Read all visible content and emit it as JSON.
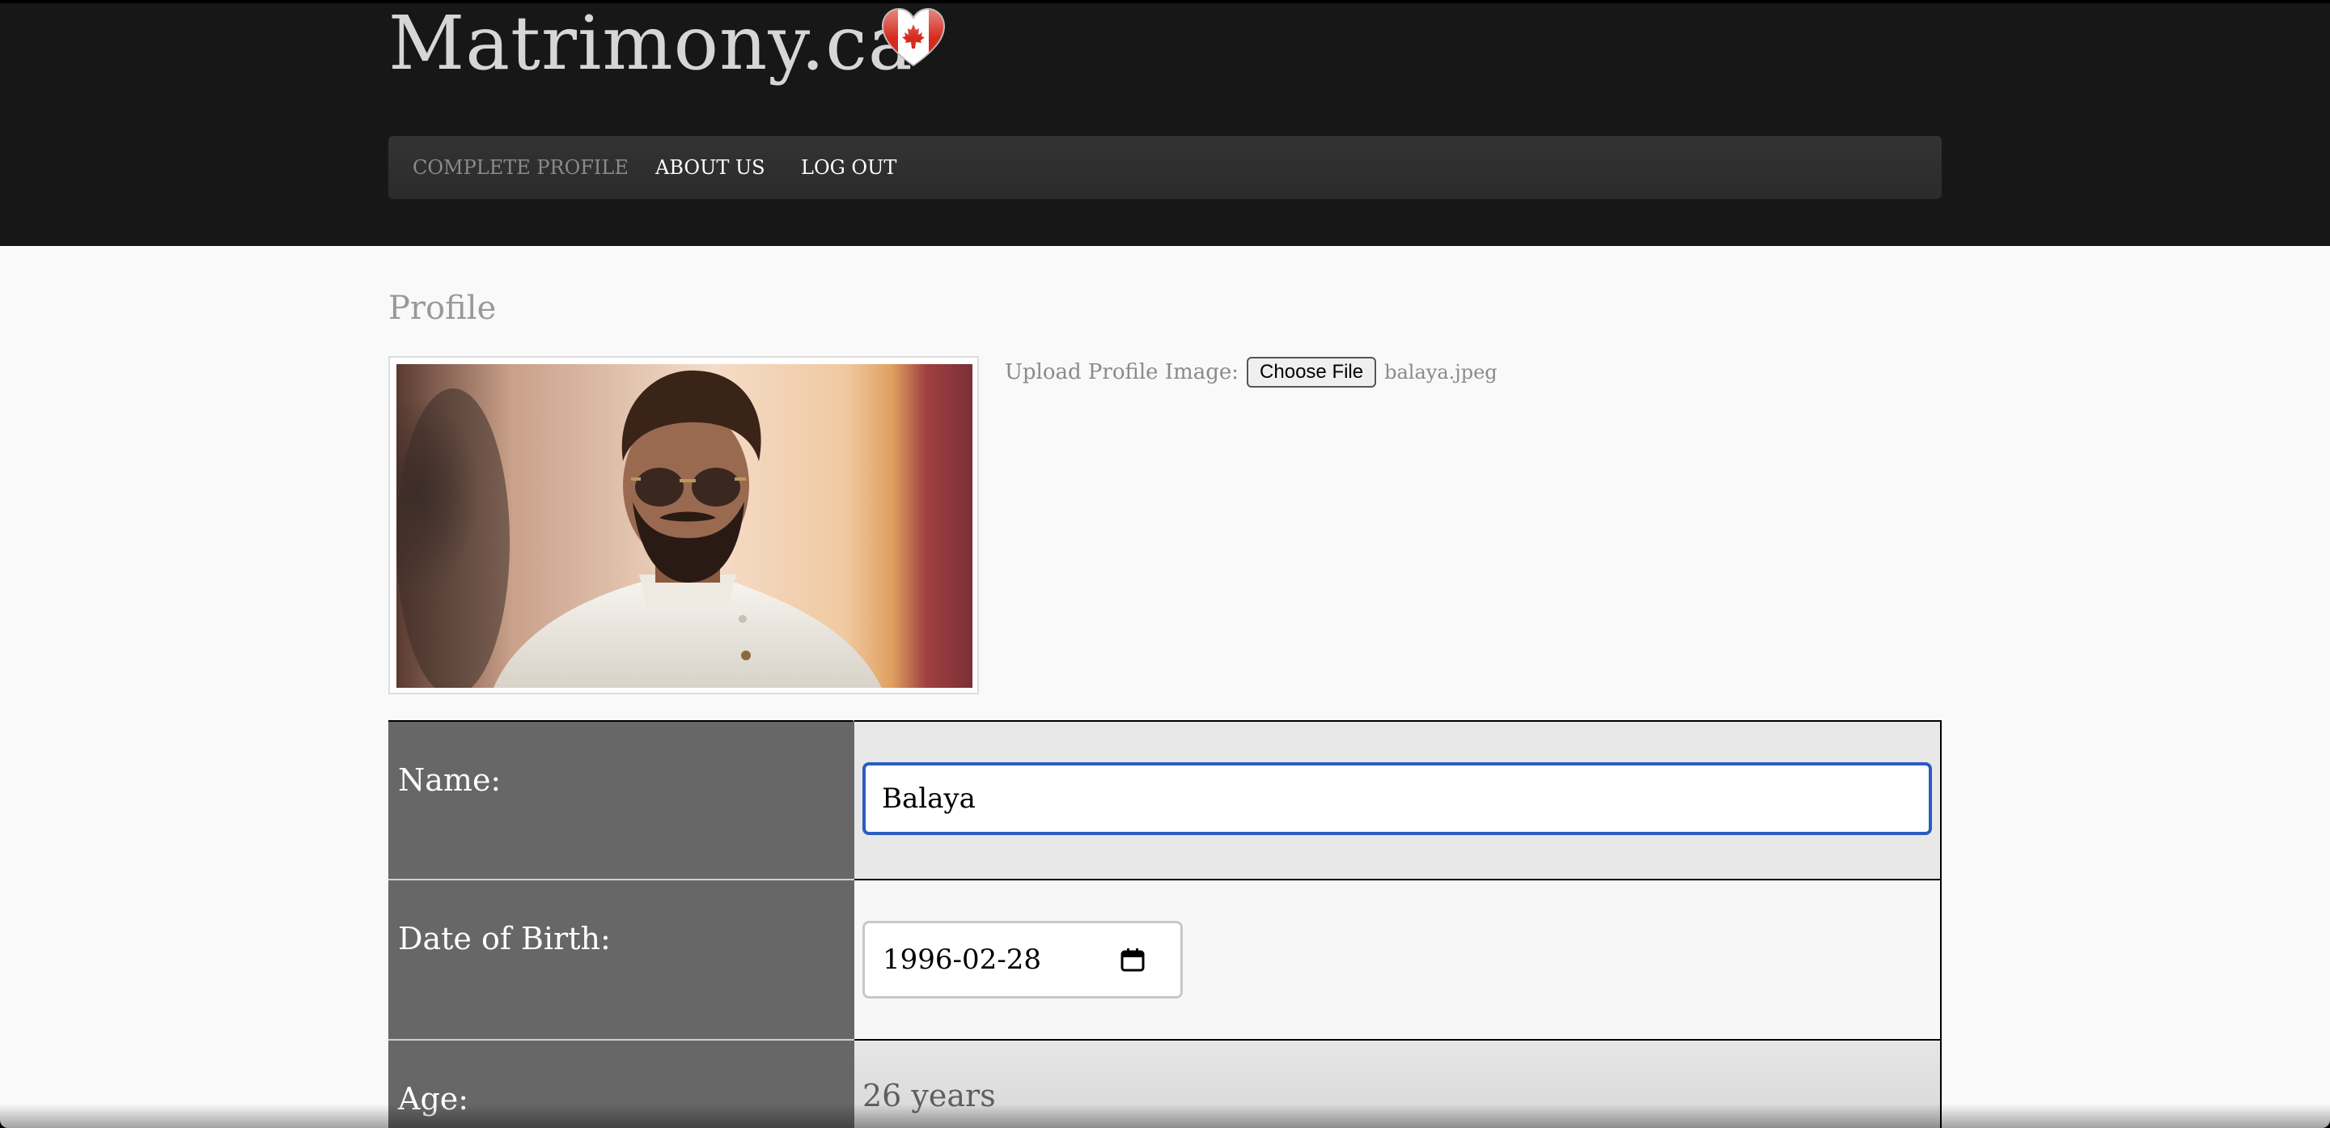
{
  "header": {
    "site_title": "Matrimony.ca",
    "logo_icon": "canada-flag-heart-icon",
    "nav": [
      {
        "label": "COMPLETE PROFILE",
        "active": false
      },
      {
        "label": "ABOUT US",
        "active": true
      },
      {
        "label": "LOG OUT",
        "active": true
      }
    ]
  },
  "main": {
    "page_title": "Profile",
    "upload": {
      "label": "Upload Profile Image:",
      "button_label": "Choose File",
      "file_name": "balaya.jpeg"
    },
    "form": {
      "name_label": "Name:",
      "name_value": "Balaya",
      "dob_label": "Date of Birth:",
      "dob_value": "1996-02-28",
      "age_label": "Age:",
      "age_value": "26 years"
    }
  },
  "colors": {
    "header_bg": "#171717",
    "navbar_bg": "#2f2f2f",
    "label_cell_bg": "#676767",
    "focus_ring": "#2a5dbf",
    "page_bg": "#f9f9f9"
  }
}
